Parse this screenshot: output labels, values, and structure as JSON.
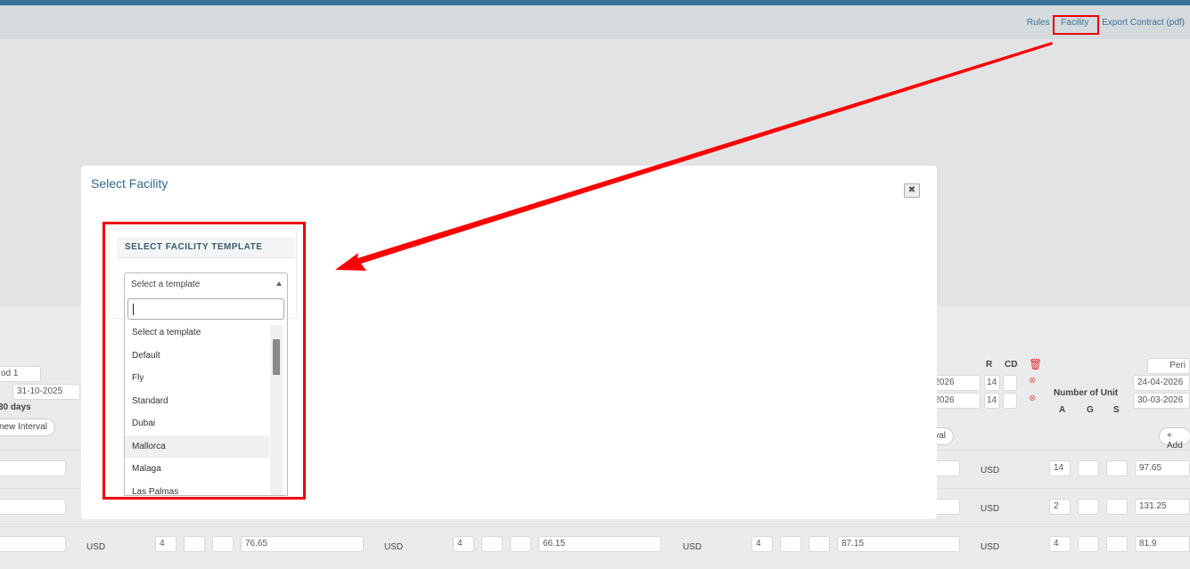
{
  "nav": {
    "rules": "Rules",
    "facility": "Facility",
    "export": "Export Contract (pdf)"
  },
  "modal": {
    "title": "Select Facility",
    "close_icon": "close-icon",
    "section_heading": "SELECT FACILITY TEMPLATE",
    "select_value": "Select a template",
    "search_value": "",
    "options": [
      "Select a template",
      "Default",
      "Fly",
      "Standard",
      "Dubai",
      "Mallorca",
      "Malaga",
      "Las Palmas"
    ],
    "hovered_option": "Mallorca"
  },
  "background": {
    "period1_label": "od 1",
    "date1": "31-10-2025",
    "days": "30 days",
    "new_interval": "new Interval",
    "col_r": "R",
    "col_cd": "CD",
    "trash_icon": "trash-icon",
    "date_right1": "-2026",
    "date_right2": "-2026",
    "r_val1": "14",
    "r_val2": "14",
    "number_of_unit": "Number of Unit",
    "unit_cols": [
      "A",
      "G",
      "S"
    ],
    "period_right": "Peri",
    "date_far1": "24-04-2026",
    "date_far2": "30-03-2026",
    "add_btn": "+ Add",
    "interval_right": "val",
    "currency": "USD",
    "row1": {
      "units": "14",
      "price": "97.65"
    },
    "row2": {
      "units": "2",
      "price": "131.25"
    },
    "row3": {
      "q1": "4",
      "p1": "76.65",
      "q2": "4",
      "p2": "66.15",
      "q3": "4",
      "p3": "87.15",
      "q4": "4",
      "p4": "81.9"
    }
  },
  "colors": {
    "accent": "#3a7199",
    "highlight": "#ee0000"
  }
}
